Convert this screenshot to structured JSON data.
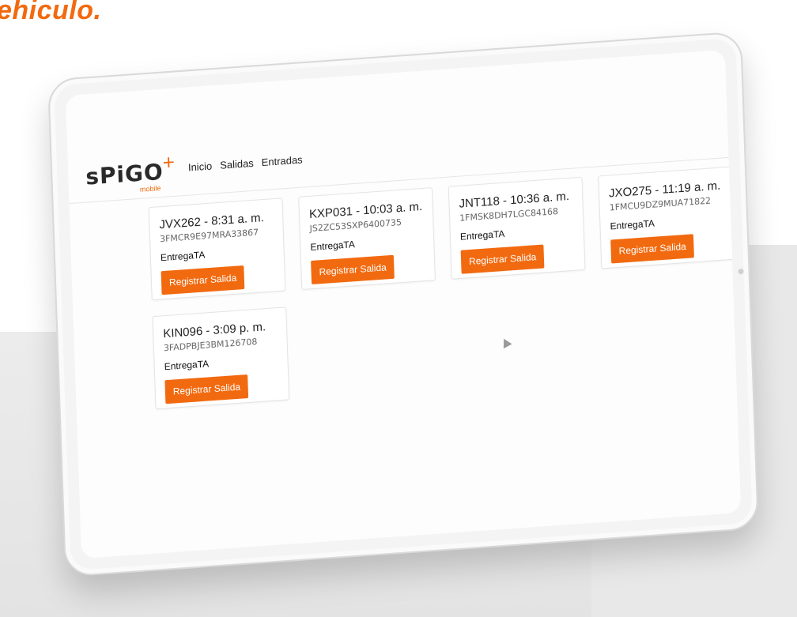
{
  "headline": "ehiculo.",
  "brand": {
    "logo_text": "sPiGO",
    "logo_plus": "+",
    "logo_sub": "mobile",
    "accent_color": "#f26a0f"
  },
  "nav": {
    "items": [
      {
        "label": "Inicio"
      },
      {
        "label": "Salidas"
      },
      {
        "label": "Entradas"
      }
    ]
  },
  "vehicles": [
    {
      "title": "JVX262 - 8:31 a. m.",
      "vin": "3FMCR9E97MRA33867",
      "status": "EntregaTA",
      "button": "Registrar Salida"
    },
    {
      "title": "KXP031 - 10:03 a. m.",
      "vin": "JS2ZC53SXP6400735",
      "status": "EntregaTA",
      "button": "Registrar Salida"
    },
    {
      "title": "JNT118 - 10:36 a. m.",
      "vin": "1FMSK8DH7LGC84168",
      "status": "EntregaTA",
      "button": "Registrar Salida"
    },
    {
      "title": "JXO275 - 11:19 a. m.",
      "vin": "1FMCU9DZ9MUA71822",
      "status": "EntregaTA",
      "button": "Registrar Salida"
    },
    {
      "title": "KIN096 - 3:09 p. m.",
      "vin": "3FADPBJE3BM126708",
      "status": "EntregaTA",
      "button": "Registrar Salida"
    }
  ]
}
